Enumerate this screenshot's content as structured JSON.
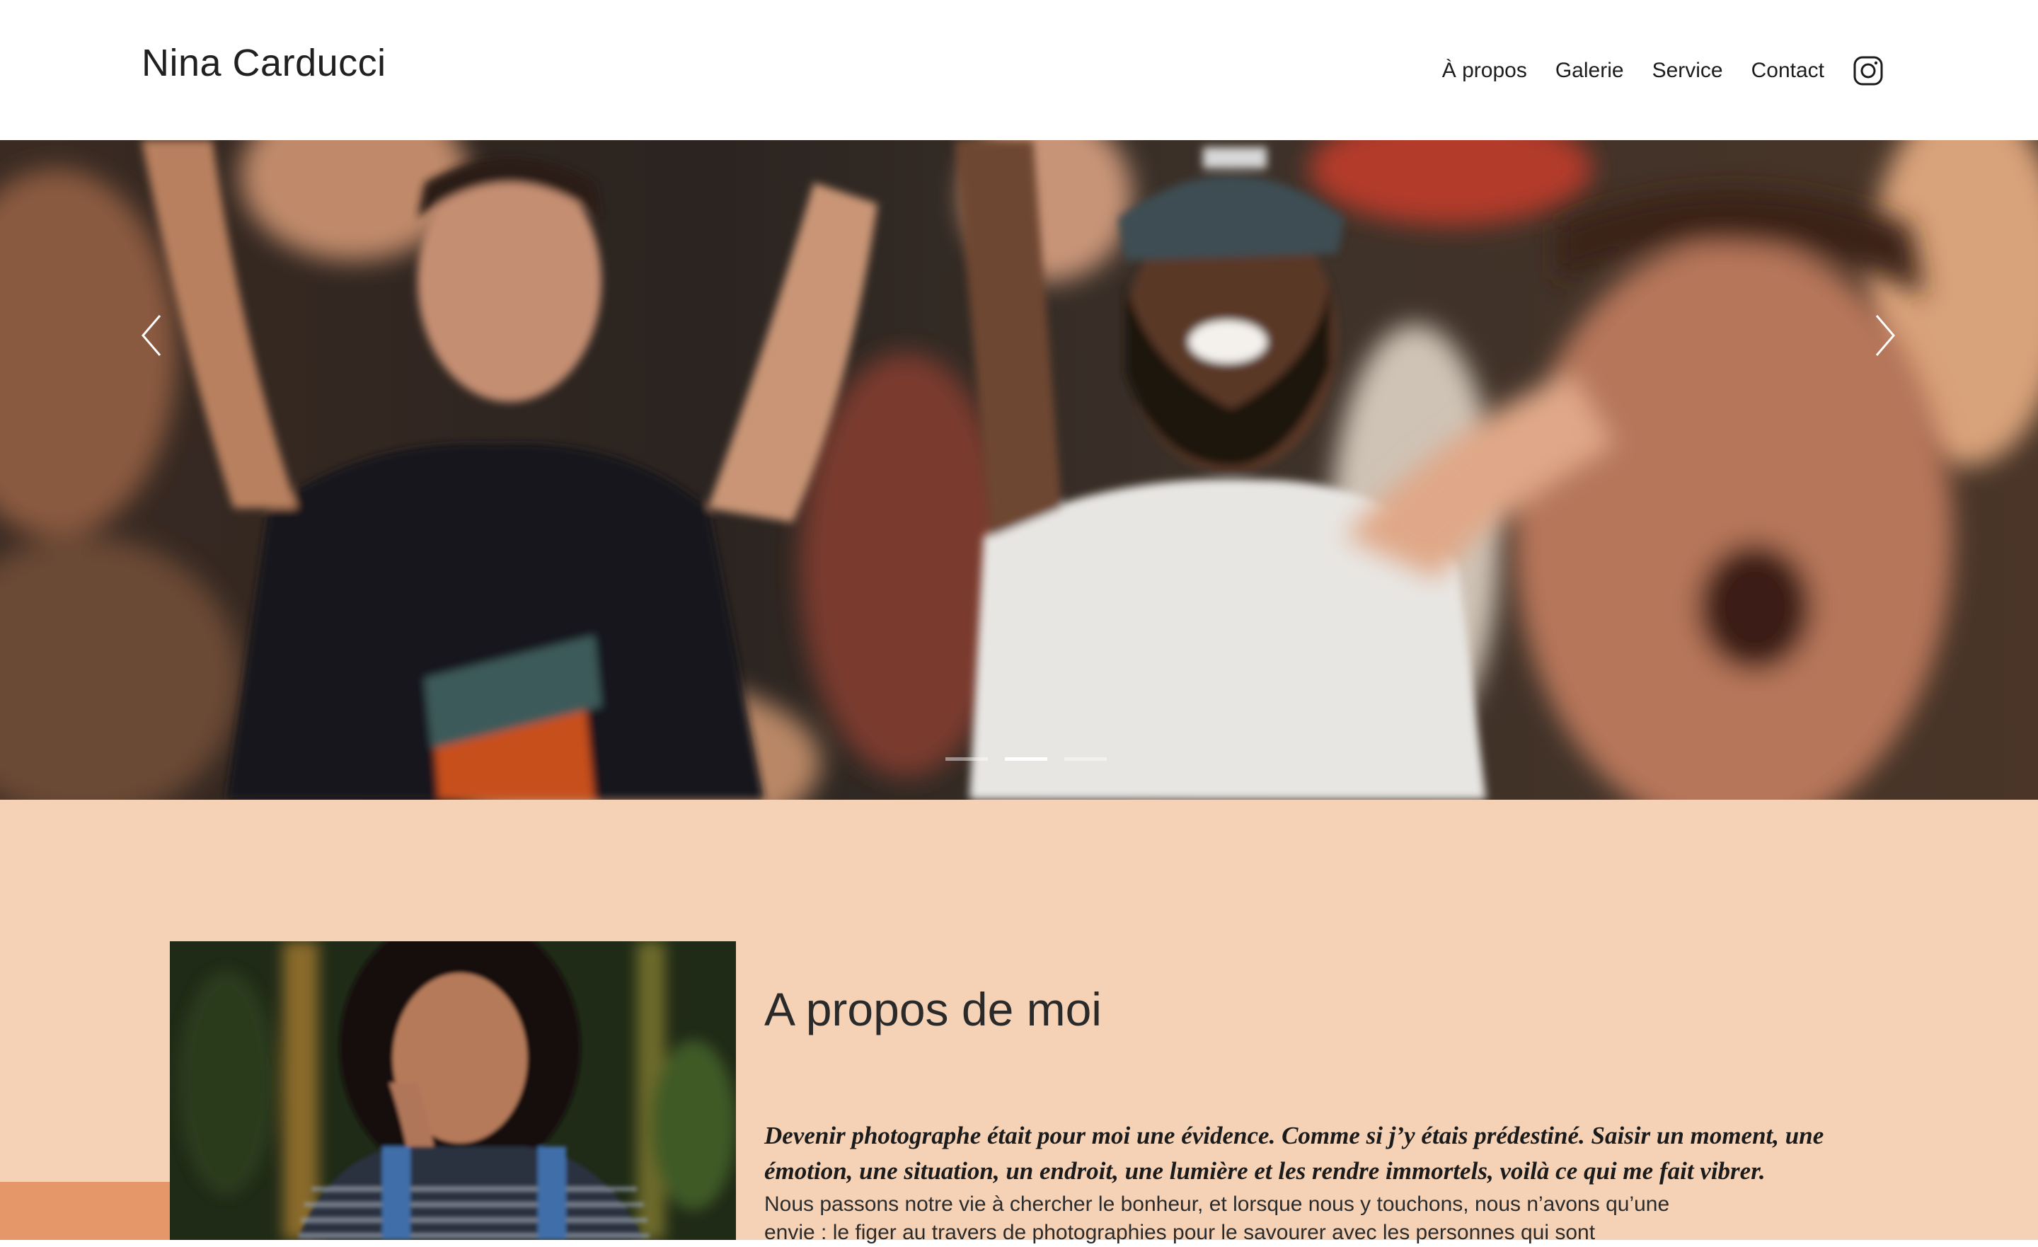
{
  "header": {
    "brand": "Nina Carducci",
    "nav": [
      "À propos",
      "Galerie",
      "Service",
      "Contact"
    ],
    "instagram_icon": "instagram-icon"
  },
  "hero": {
    "prev_icon": "chevron-left-icon",
    "next_icon": "chevron-right-icon",
    "slide_count": 3,
    "active_slide": 2,
    "image": "concert crowd photo"
  },
  "about": {
    "title": "A propos de moi",
    "lead": "Devenir photographe était pour moi une évidence. Comme si j’y étais prédestiné. Saisir un moment, une émotion, une situation, un endroit, une lumière et les rendre immortels, voilà ce qui me fait vibrer.",
    "body": "Nous passons notre vie à chercher le bonheur, et lorsque nous y touchons, nous n’avons qu’une envie : le figer au travers de photographies pour le savourer avec les personnes qui sont",
    "portrait": "portrait photo"
  },
  "colors": {
    "about_bg": "#f5d2b6",
    "accent_orange": "#e5976a"
  }
}
